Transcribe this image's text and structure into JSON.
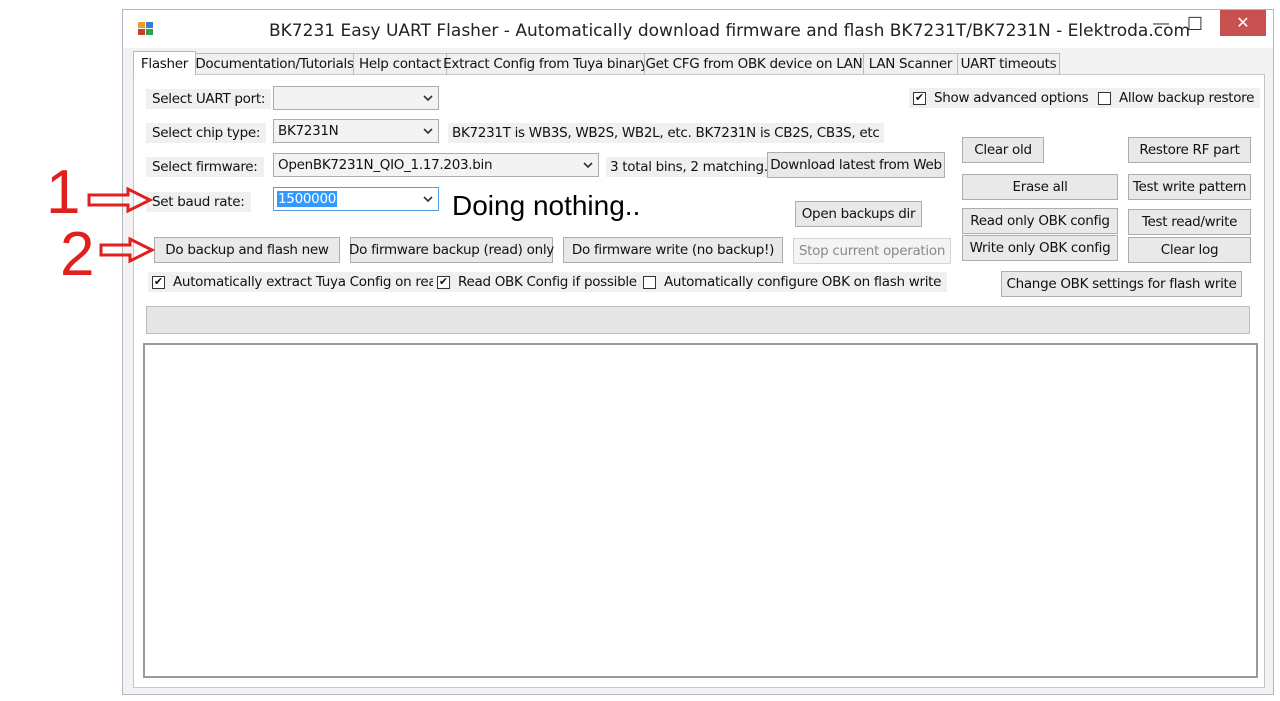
{
  "window": {
    "title": "BK7231 Easy UART Flasher - Automatically download firmware and flash BK7231T/BK7231N  - Elektroda.com",
    "close_glyph": "✕",
    "maximize_glyph": "☐",
    "minimize_glyph": "—"
  },
  "tabs": [
    {
      "label": "Flasher"
    },
    {
      "label": "Documentation/Tutorials"
    },
    {
      "label": "Help contact"
    },
    {
      "label": "Extract Config from Tuya binary"
    },
    {
      "label": "Get CFG from OBK device on LAN"
    },
    {
      "label": "LAN Scanner"
    },
    {
      "label": "UART timeouts"
    }
  ],
  "form": {
    "uart_port_label": "Select UART port:",
    "uart_port_value": "",
    "chip_type_label": "Select chip type:",
    "chip_type_value": "BK7231N",
    "chip_info": "BK7231T is WB3S, WB2S, WB2L, etc. BK7231N is CB2S, CB3S, etc",
    "firmware_label": "Select firmware:",
    "firmware_value": "OpenBK7231N_QIO_1.17.203.bin",
    "firmware_info": "3 total bins, 2 matching.",
    "baud_label": "Set baud rate:",
    "baud_value": "1500000",
    "status_text": "Doing nothing.."
  },
  "buttons": {
    "download_latest": "Download latest from Web",
    "open_backups": "Open backups dir",
    "backup_and_flash": "Do backup and flash new",
    "backup_read_only": "Do firmware backup (read) only",
    "write_no_backup": "Do firmware write (no backup!)",
    "stop_operation": "Stop current operation",
    "clear_old": "Clear old",
    "restore_rf": "Restore RF part",
    "erase_all": "Erase all",
    "test_write_pattern": "Test write pattern",
    "read_obk_config": "Read only OBK config",
    "test_read_write": "Test read/write",
    "write_obk_config": "Write only OBK config",
    "clear_log": "Clear log",
    "change_obk_settings": "Change OBK settings for flash write"
  },
  "checkboxes": {
    "show_advanced": {
      "label": "Show advanced options",
      "checked": true
    },
    "allow_backup_restore": {
      "label": "Allow backup restore",
      "checked": false
    },
    "auto_extract_tuya": {
      "label": "Automatically extract Tuya Config on read",
      "checked": true
    },
    "read_obk_config": {
      "label": "Read OBK Config if possible",
      "checked": true
    },
    "auto_configure_obk": {
      "label": "Automatically configure OBK on flash write",
      "checked": false
    }
  },
  "annotations": {
    "marker_1": "1",
    "marker_2": "2"
  },
  "colors": {
    "annotation": "#e0201e",
    "close_button": "#c75050",
    "selection": "#3399ff"
  }
}
